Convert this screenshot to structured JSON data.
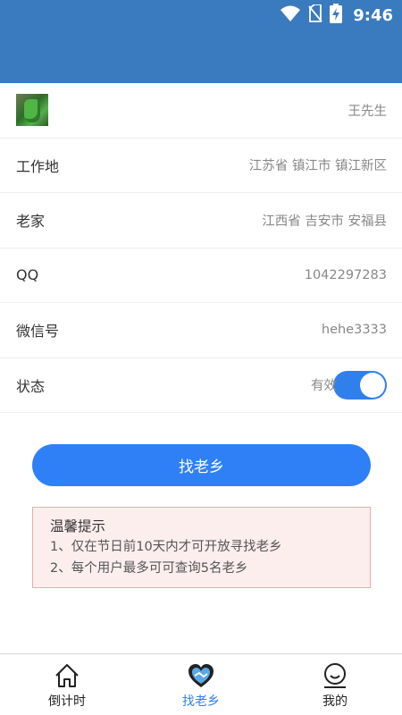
{
  "status_bar": {
    "time": "9:46",
    "icons": [
      "wifi-icon",
      "no-sim-icon",
      "battery-charging-icon"
    ]
  },
  "profile": {
    "name": "王先生",
    "rows": [
      {
        "label": "工作地",
        "value": "江苏省 镇江市 镇江新区"
      },
      {
        "label": "老家",
        "value": "江西省 吉安市 安福县"
      },
      {
        "label": "QQ",
        "value": "1042297283"
      },
      {
        "label": "微信号",
        "value": "hehe3333"
      }
    ],
    "status": {
      "label": "状态",
      "value": "有效",
      "enabled": true
    }
  },
  "action_button": "找老乡",
  "tips": {
    "title": "温馨提示",
    "lines": [
      "1、仅在节日前10天内才可开放寻找老乡",
      "2、每个用户最多可可查询5名老乡"
    ]
  },
  "tabbar": {
    "tabs": [
      {
        "label": "倒计时",
        "icon": "home-icon",
        "active": false
      },
      {
        "label": "找老乡",
        "icon": "handshake-heart-icon",
        "active": true
      },
      {
        "label": "我的",
        "icon": "profile-face-icon",
        "active": false
      }
    ]
  },
  "colors": {
    "header": "#3a7abf",
    "accent": "#2f80ed",
    "tips_bg": "#fdeeee",
    "tips_border": "#f0a8a8"
  }
}
